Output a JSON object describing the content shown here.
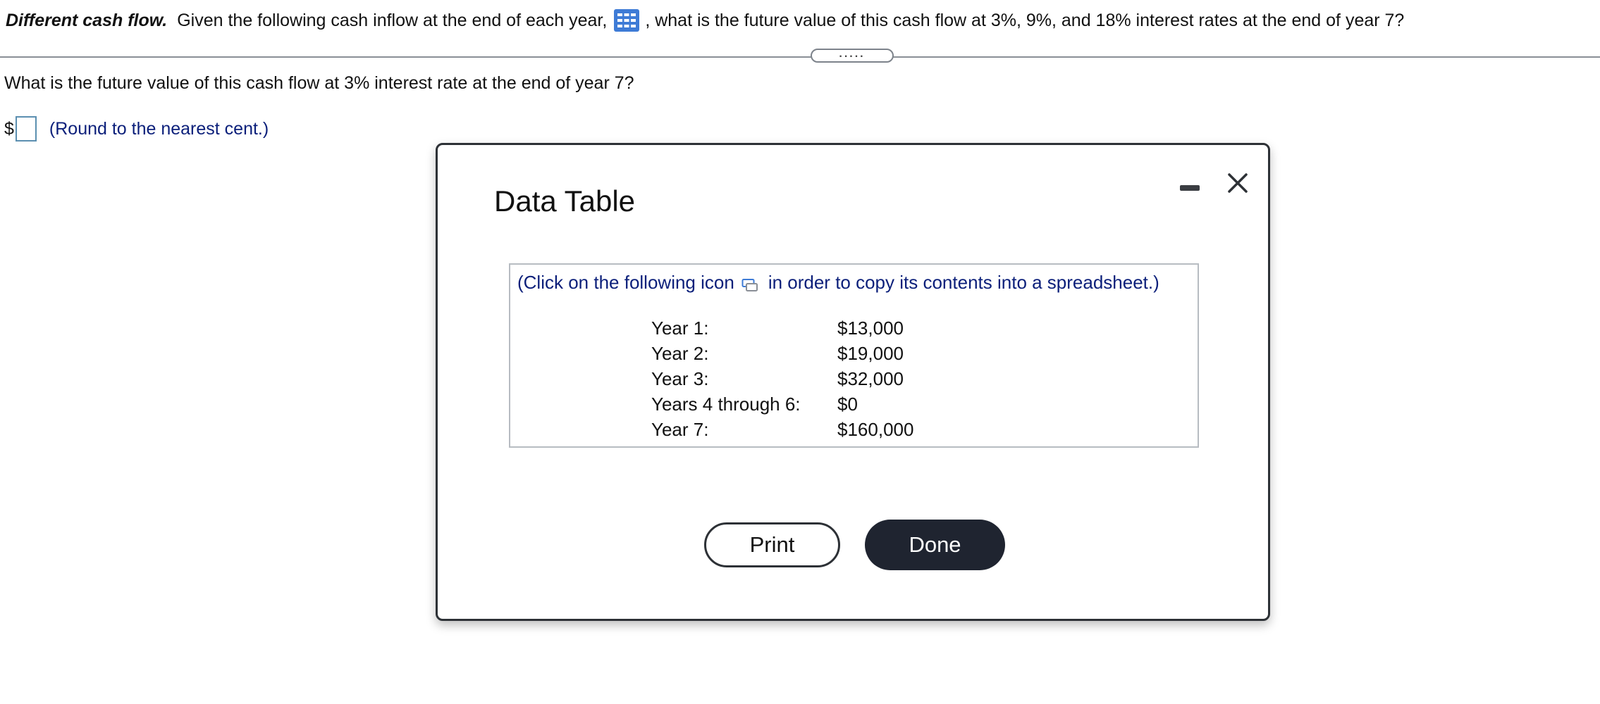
{
  "question": {
    "title": "Different cash flow.",
    "text_before_icon": "Given the following cash inflow at the end of each year,",
    "text_after_icon": ", what is the future value of this cash flow at 3%, 9%, and 18% interest rates at the end of year 7?"
  },
  "divider": {
    "handle_label": "....."
  },
  "subquestion": {
    "text": "What is the future value of this cash flow at 3% interest rate at the end of year 7?"
  },
  "answer": {
    "currency_symbol": "$",
    "value": "",
    "hint": "(Round to the nearest cent.)"
  },
  "modal": {
    "title": "Data Table",
    "copy_note_before_icon": "(Click on the following icon",
    "copy_note_after_icon": "in order to copy its contents into a spreadsheet.)",
    "rows": [
      {
        "label": "Year 1:",
        "value": "$13,000"
      },
      {
        "label": "Year 2:",
        "value": "$19,000"
      },
      {
        "label": "Year 3:",
        "value": "$32,000"
      },
      {
        "label": "Years 4 through 6:",
        "value": "$0"
      },
      {
        "label": "Year 7:",
        "value": "$160,000"
      }
    ],
    "print_label": "Print",
    "done_label": "Done"
  },
  "colors": {
    "link_blue": "#0b1f7a",
    "icon_blue": "#3e7bd6",
    "done_button": "#1f2430",
    "modal_border": "#2d3136"
  },
  "icons": {
    "table_icon": "grid-table-icon",
    "copy_icon": "copy-spreadsheet-icon",
    "minimize_icon": "minimize-icon",
    "close_icon": "close-icon"
  }
}
